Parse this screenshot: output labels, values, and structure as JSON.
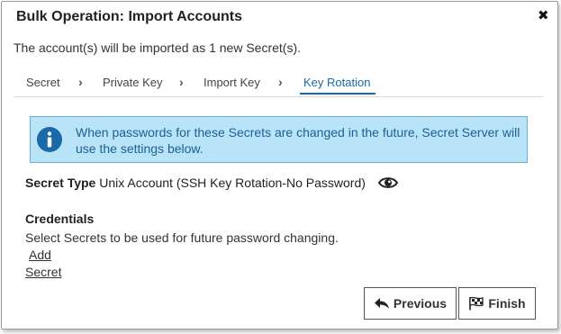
{
  "dialog": {
    "title": "Bulk Operation: Import Accounts",
    "close_icon": "close-icon",
    "subtitle": "The account(s) will be imported as 1 new Secret(s)."
  },
  "steps": [
    {
      "label": "Secret",
      "active": false
    },
    {
      "label": "Private Key",
      "active": false
    },
    {
      "label": "Import Key",
      "active": false
    },
    {
      "label": "Key Rotation",
      "active": true
    }
  ],
  "info": {
    "icon": "info-icon",
    "text": "When passwords for these Secrets are changed in the future, Secret Server will use the settings below."
  },
  "secret_type": {
    "label": "Secret Type",
    "value": "Unix Account (SSH Key Rotation-No Password)",
    "icon": "eye-icon"
  },
  "credentials": {
    "title": "Credentials",
    "description": "Select Secrets to be used for future password changing.",
    "add_link": "Add",
    "secret_link": "Secret"
  },
  "buttons": {
    "previous": "Previous",
    "finish": "Finish"
  },
  "colors": {
    "accent": "#1a6aa8",
    "info_bg": "#b9e3f6",
    "info_border": "#6aaed6",
    "info_icon": "#1a6aa8"
  }
}
